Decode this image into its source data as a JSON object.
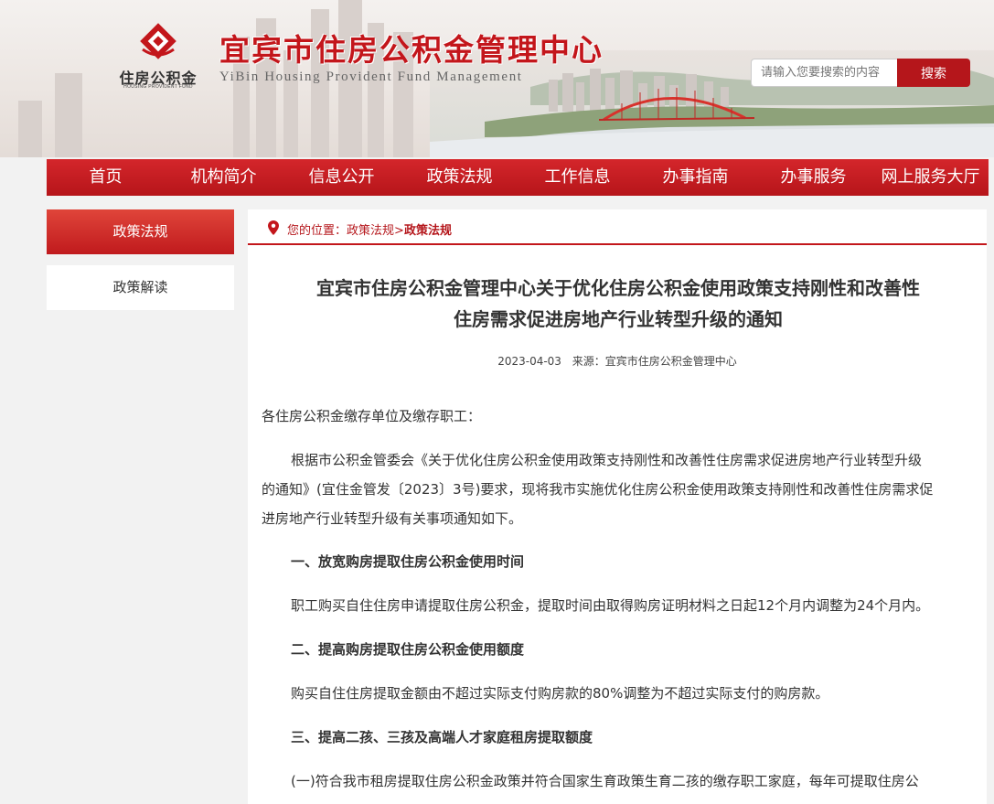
{
  "header": {
    "logo_cn": "住房公积金",
    "logo_en": "HOUSING PROVIDENT FUND",
    "site_title": "宜宾市住房公积金管理中心",
    "site_subtitle": "YiBin Housing Provident Fund Management",
    "search": {
      "placeholder": "请输入您要搜索的内容",
      "button": "搜索"
    },
    "brand_color": "#c3161b"
  },
  "nav": {
    "items": [
      "首页",
      "机构简介",
      "信息公开",
      "政策法规",
      "工作信息",
      "办事指南",
      "办事服务",
      "网上服务大厅"
    ]
  },
  "sidebar": {
    "active": "政策法规",
    "items": [
      "政策解读"
    ]
  },
  "breadcrumb": {
    "prefix": "您的位置：",
    "level1": "政策法规",
    "sep": ">",
    "current": "政策法规"
  },
  "article": {
    "title_line1": "宜宾市住房公积金管理中心关于优化住房公积金使用政策支持刚性和改善性",
    "title_line2": "住房需求促进房地产行业转型升级的通知",
    "date": "2023-04-03",
    "source": "来源：宜宾市住房公积金管理中心",
    "paragraphs": [
      "各住房公积金缴存单位及缴存职工：",
      "根据市公积金管委会《关于优化住房公积金使用政策支持刚性和改善性住房需求促进房地产行业转型升级",
      "的通知》(宜住金管发〔2023〕3号)要求，现将我市实施优化住房公积金使用政策支持刚性和改善性住房需求促",
      "进房地产行业转型升级有关事项通知如下。",
      "一、放宽购房提取住房公积金使用时间",
      "职工购买自住住房申请提取住房公积金，提取时间由取得购房证明材料之日起12个月内调整为24个月内。",
      "二、提高购房提取住房公积金使用额度",
      "购买自住住房提取金额由不超过实际支付购房款的80%调整为不超过实际支付的购房款。",
      "三、提高二孩、三孩及高端人才家庭租房提取额度",
      "(一)符合我市租房提取住房公积金政策并符合国家生育政策生育二孩的缴存职工家庭，每年可提取住房公"
    ]
  }
}
